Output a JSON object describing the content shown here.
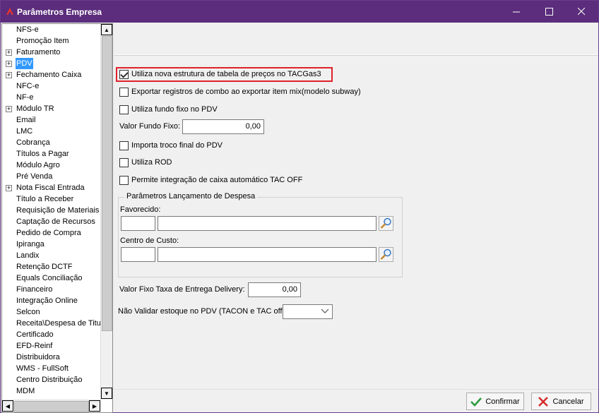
{
  "window": {
    "title": "Parâmetros Empresa",
    "icon": "company-logo-icon",
    "controls": {
      "minimize": "—",
      "maximize": "☐",
      "close": "✕"
    }
  },
  "tree": {
    "items": [
      {
        "label": "NFS-e",
        "expandable": false
      },
      {
        "label": "Promoção Item",
        "expandable": false
      },
      {
        "label": "Faturamento",
        "expandable": true
      },
      {
        "label": "PDV",
        "expandable": true,
        "selected": true
      },
      {
        "label": "Fechamento Caixa",
        "expandable": true
      },
      {
        "label": "NFC-e",
        "expandable": false
      },
      {
        "label": "NF-e",
        "expandable": false
      },
      {
        "label": "Módulo TR",
        "expandable": true
      },
      {
        "label": "Email",
        "expandable": false
      },
      {
        "label": "LMC",
        "expandable": false
      },
      {
        "label": "Cobrança",
        "expandable": false
      },
      {
        "label": "Títulos a Pagar",
        "expandable": false
      },
      {
        "label": "Módulo Agro",
        "expandable": false
      },
      {
        "label": "Pré Venda",
        "expandable": false
      },
      {
        "label": "Nota Fiscal Entrada",
        "expandable": true
      },
      {
        "label": "Título a Receber",
        "expandable": false
      },
      {
        "label": "Requisição de Materiais",
        "expandable": false
      },
      {
        "label": "Captação de Recursos",
        "expandable": false
      },
      {
        "label": "Pedido de Compra",
        "expandable": false
      },
      {
        "label": "Ipiranga",
        "expandable": false
      },
      {
        "label": "Landix",
        "expandable": false
      },
      {
        "label": "Retenção DCTF",
        "expandable": false
      },
      {
        "label": "Equals Conciliação",
        "expandable": false
      },
      {
        "label": "Financeiro",
        "expandable": false
      },
      {
        "label": "Integração Online",
        "expandable": false
      },
      {
        "label": "Selcon",
        "expandable": false
      },
      {
        "label": "Receita\\Despesa de Titul",
        "expandable": false
      },
      {
        "label": "Certificado",
        "expandable": false
      },
      {
        "label": "EFD-Reinf",
        "expandable": false
      },
      {
        "label": "Distribuidora",
        "expandable": false
      },
      {
        "label": "WMS - FullSoft",
        "expandable": false
      },
      {
        "label": "Centro Distribuição",
        "expandable": false
      },
      {
        "label": "MDM",
        "expandable": false
      }
    ],
    "scroll_up": "▲",
    "scroll_down": "▼",
    "scroll_left": "◀",
    "scroll_right": "▶"
  },
  "pdv": {
    "options": {
      "nova_estrutura": {
        "label": "Utiliza nova estrutura de tabela de preços no TACGas3",
        "checked": true
      },
      "exportar_combo": {
        "label": "Exportar registros de combo ao exportar item mix(modelo subway)",
        "checked": false
      },
      "fundo_fixo": {
        "label": "Utiliza fundo fixo no PDV",
        "checked": false
      },
      "troco_final": {
        "label": "Importa troco final do PDV",
        "checked": false
      },
      "rod": {
        "label": "Utiliza ROD",
        "checked": false
      },
      "integracao_caixa": {
        "label": "Permite integração de caixa automático TAC OFF",
        "checked": false
      }
    },
    "valor_fundo_fixo": {
      "label": "Valor Fundo Fixo:",
      "value": "0,00"
    },
    "despesa_group": {
      "title": "Parâmetros Lançamento de Despesa",
      "favorecido_label": "Favorecido:",
      "favorecido_code": "",
      "favorecido_name": "",
      "centro_label": "Centro de Custo:",
      "centro_code": "",
      "centro_name": ""
    },
    "taxa_entrega": {
      "label": "Valor Fixo Taxa de Entrega Delivery:",
      "value": "0,00"
    },
    "validar_estoque": {
      "label": "Não Validar estoque no PDV (TACON e TAC off):",
      "value": ""
    }
  },
  "footer": {
    "confirm_label": "Confirmar",
    "cancel_label": "Cancelar"
  },
  "colors": {
    "titlebar": "#5b2d7c",
    "highlight": "#e0202a",
    "selection": "#3399ff"
  }
}
